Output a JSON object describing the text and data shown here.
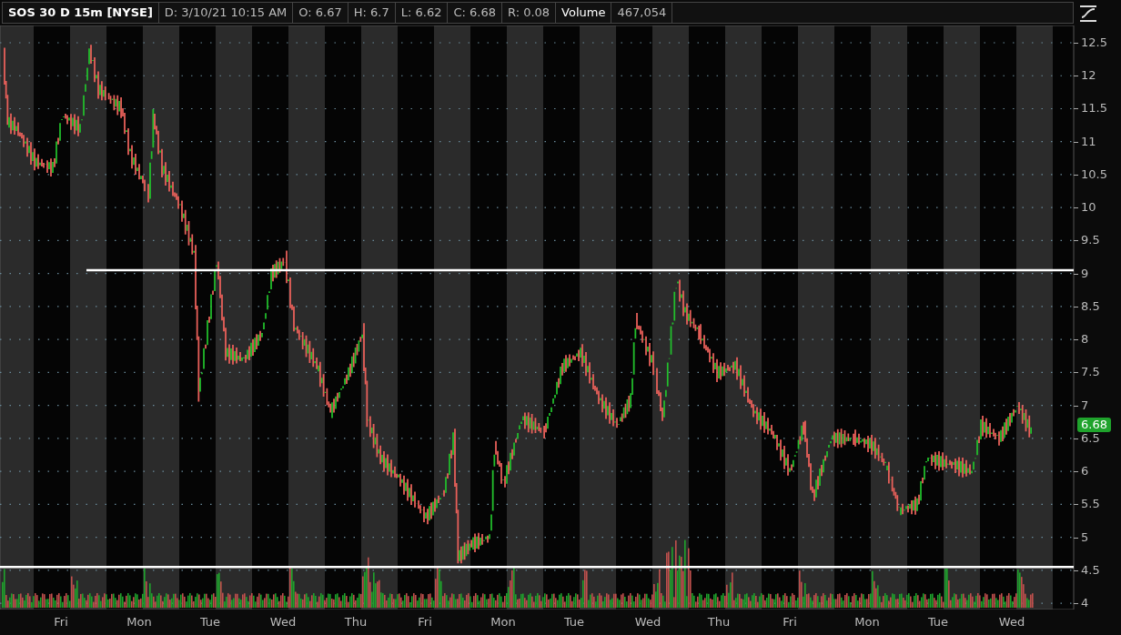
{
  "header": [
    {
      "kind": "symbol",
      "text": "SOS 30 D 15m [NYSE]"
    },
    {
      "kind": "value",
      "text": "D: 3/10/21 10:15 AM"
    },
    {
      "kind": "value",
      "text": "O: 6.67"
    },
    {
      "kind": "value",
      "text": "H: 6.7"
    },
    {
      "kind": "value",
      "text": "L: 6.62"
    },
    {
      "kind": "value",
      "text": "C: 6.68"
    },
    {
      "kind": "value",
      "text": "R: 0.08"
    },
    {
      "kind": "label",
      "text": "Volume"
    },
    {
      "kind": "value",
      "text": "467,054"
    }
  ],
  "price_axis": [
    "12.5",
    "12",
    "11.5",
    "11",
    "10.5",
    "10",
    "9.5",
    "9",
    "8.5",
    "8",
    "7.5",
    "7",
    "6.5",
    "6",
    "5.5",
    "5",
    "4.5",
    "4"
  ],
  "last_price": "6.68",
  "day_axis": [
    "Fri",
    "Mon",
    "Tue",
    "Wed",
    "Thu",
    "Fri",
    "Mon",
    "Tue",
    "Wed",
    "Thu",
    "Fri",
    "Mon",
    "Tue",
    "Wed"
  ]
}
